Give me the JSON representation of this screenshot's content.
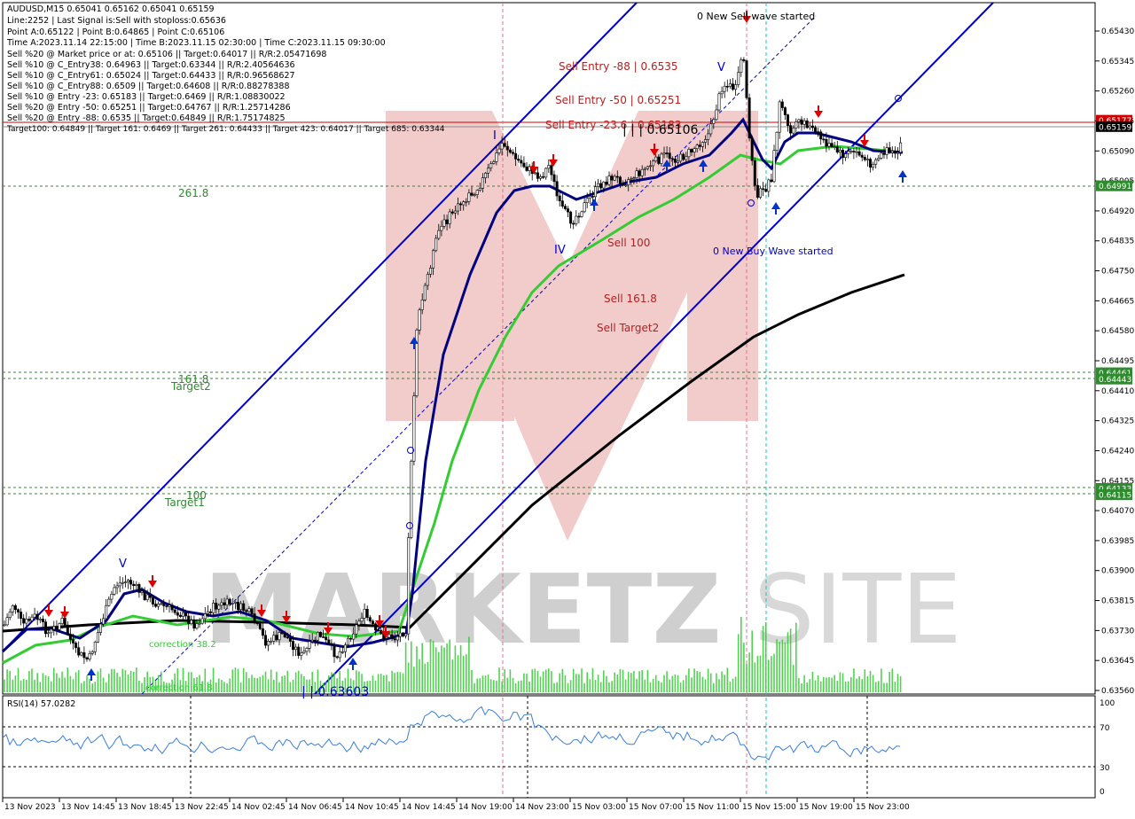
{
  "header": {
    "symbol_line": "AUDUSD,M15  0.65041 0.65162 0.65041 0.65159",
    "info_lines": [
      "Line:2252 | Last Signal is:Sell with stoploss:0.65636",
      "Point A:0.65122 | Point B:0.64865 | Point C:0.65106",
      "Time A:2023.11.14 22:15:00 | Time B:2023.11.15 02:30:00 | Time C:2023.11.15 09:30:00",
      "Sell %20 @ Market price or at: 0.65106 || Target:0.64017 || R/R:2.05471698",
      "Sell %10 @ C_Entry38: 0.64963 || Target:0.63344 || R/R:2.40564636",
      "Sell %10 @ C_Entry61: 0.65024 || Target:0.64433 || R/R:0.96568627",
      "Sell %10 @ C_Entry88: 0.6509 || Target:0.64608 || R/R:0.88278388",
      "Sell %10 @ Entry -23: 0.65183 || Target:0.6469 || R/R:1.08830022",
      "Sell %20 @ Entry -50: 0.65251 || Target:0.64767 || R/R:1.25714286",
      "Sell %20 @ Entry -88: 0.6535 || Target:0.64849 || R/R:1.75174825"
    ],
    "targets_line": "Target100: 0.64849 || Target 161: 0.6469 || Target 261: 0.64433 || Target 423: 0.64017 || Target 685: 0.63344"
  },
  "price_axis": {
    "ticks": [
      "0.65430",
      "0.65345",
      "0.65260",
      "0.65175",
      "0.65090",
      "0.65005",
      "0.64920",
      "0.64835",
      "0.64750",
      "0.64665",
      "0.64580",
      "0.64495",
      "0.64410",
      "0.64325",
      "0.64240",
      "0.64155",
      "0.64070",
      "0.63985",
      "0.63900",
      "0.63815",
      "0.63730",
      "0.63645",
      "0.63560"
    ],
    "tags": [
      {
        "label": "0.65177",
        "color": "#cc0000"
      },
      {
        "label": "0.65159",
        "color": "#000000"
      },
      {
        "label": "0.64991",
        "color": "#2e8b2e"
      },
      {
        "label": "0.64461",
        "color": "#2e8b2e"
      },
      {
        "label": "0.64443",
        "color": "#2e8b2e"
      },
      {
        "label": "0.64133",
        "color": "#2e8b2e"
      },
      {
        "label": "0.64115",
        "color": "#2e8b2e"
      }
    ]
  },
  "chart_labels": {
    "sell_entry_88": "Sell Entry -88 | 0.6535",
    "sell_entry_50": "Sell Entry -50 | 0.65251",
    "sell_entry_23": "Sell Entry -23.6 | 0.65183",
    "point_c": "| | | 0.65106",
    "new_sell_wave": "0 New Sell wave started",
    "new_buy_wave": "0 New Buy Wave started",
    "sell_100": "Sell 100",
    "sell_1618": "Sell 161.8",
    "sell_target2": "Sell Target2",
    "fib_2618": "261.8",
    "fib_1618": "161.8",
    "target2": "Target2",
    "fib_100": "100",
    "target1": "Target1",
    "correction_382": "correction 38.2",
    "correction_618": "correction 61.8",
    "low_price": "| | 0.63603",
    "wave_v1": "V",
    "wave_iv": "IV",
    "wave_i": "I",
    "wave_v2": "V"
  },
  "rsi": {
    "label": "RSI(14) 57.0282",
    "ticks": [
      "100",
      "70",
      "30",
      "0"
    ]
  },
  "time_axis": {
    "labels": [
      "13 Nov 2023",
      "13 Nov 14:45",
      "13 Nov 18:45",
      "13 Nov 22:45",
      "14 Nov 02:45",
      "14 Nov 06:45",
      "14 Nov 10:45",
      "14 Nov 14:45",
      "14 Nov 19:00",
      "14 Nov 23:00",
      "15 Nov 03:00",
      "15 Nov 07:00",
      "15 Nov 11:00",
      "15 Nov 15:00",
      "15 Nov 19:00",
      "15 Nov 23:00"
    ]
  },
  "watermark": {
    "text_a": "MARKETZ",
    "text_b": "SITE"
  },
  "colors": {
    "channel": "#0000cc",
    "ma_fast": "#000080",
    "ma_mid": "#33cc33",
    "ma_slow": "#000000",
    "sell_arrow": "#e00000",
    "buy_arrow": "#0033cc",
    "target_line": "#2e8b2e",
    "stop_line": "#cc0000",
    "label_red": "#b22222"
  }
}
